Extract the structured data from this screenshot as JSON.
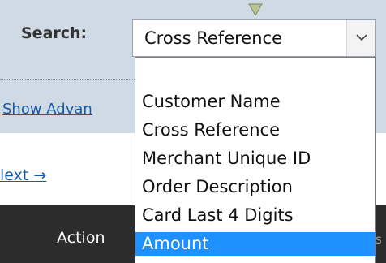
{
  "search": {
    "label": "Search:",
    "selected_value": "Cross Reference",
    "options": [
      "Customer Name",
      "Cross Reference",
      "Merchant Unique ID",
      "Order Description",
      "Card Last 4 Digits",
      "Amount"
    ],
    "highlighted_option": "Amount"
  },
  "links": {
    "show_advanced": "Show Advan",
    "next": "lext →"
  },
  "table": {
    "action_header": "Action",
    "edge_header_fragment": "s"
  },
  "colors": {
    "panel_bg": "#cfdae5",
    "link": "#1a5aa6",
    "header_bar": "#2c2c2c",
    "highlight": "#1e90ff"
  },
  "icons": {
    "dropdown_arrow": "chevron-down-icon",
    "pin": "triangle-down-icon"
  }
}
